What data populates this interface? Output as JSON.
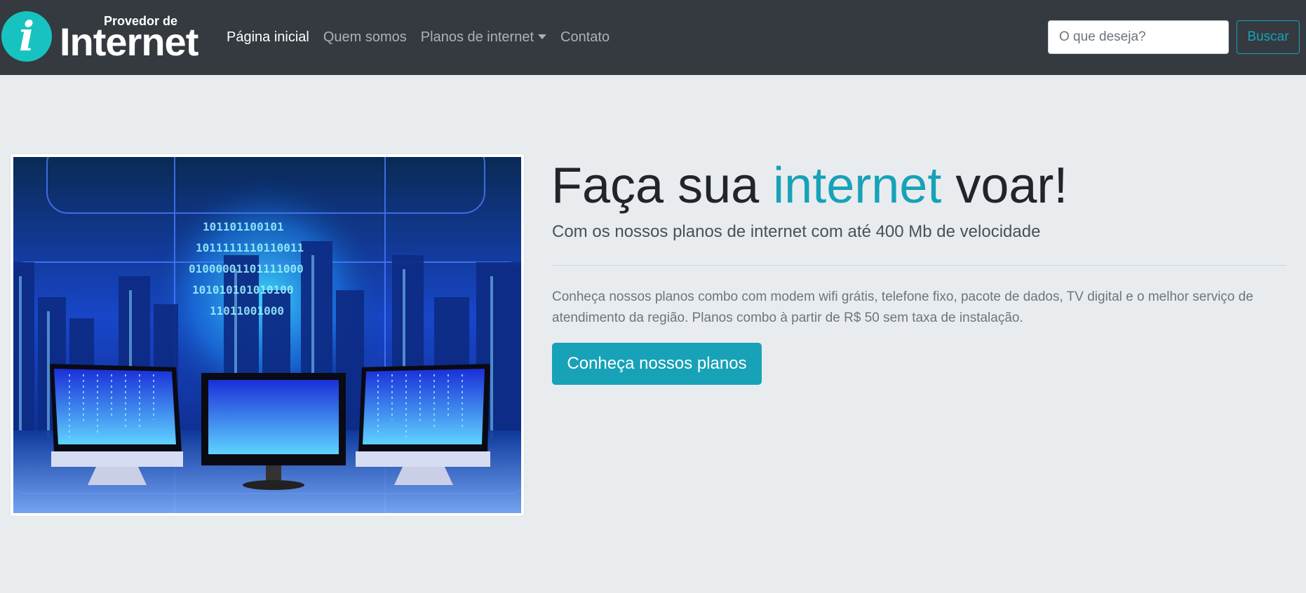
{
  "navbar": {
    "brand": {
      "top_text": "Provedor de",
      "main_text": "Internet",
      "icon": "info-i-icon"
    },
    "links": [
      {
        "label": "Página inicial",
        "active": true
      },
      {
        "label": "Quem somos",
        "active": false
      },
      {
        "label": "Planos de internet",
        "active": false,
        "dropdown": true
      },
      {
        "label": "Contato",
        "active": false
      }
    ],
    "search": {
      "placeholder": "O que deseja?",
      "button_label": "Buscar"
    }
  },
  "hero": {
    "image": "computer-monitors-city-binary-image",
    "headline": {
      "before": "Faça sua ",
      "accent": "internet",
      "after": " voar!"
    },
    "lead": "Com os nossos planos de internet com até 400 Mb de velocidade",
    "body": "Conheça nossos planos combo com modem wifi grátis, telefone fixo, pacote de dados, TV digital e o melhor serviço de atendimento da região. Planos combo à partir de R$ 50 sem taxa de instalação.",
    "cta_label": "Conheça nossos planos"
  },
  "colors": {
    "navbar_bg": "#343a40",
    "page_bg": "#e9ecef",
    "accent": "#17a2b8",
    "brand_circle": "#17c3c1"
  }
}
